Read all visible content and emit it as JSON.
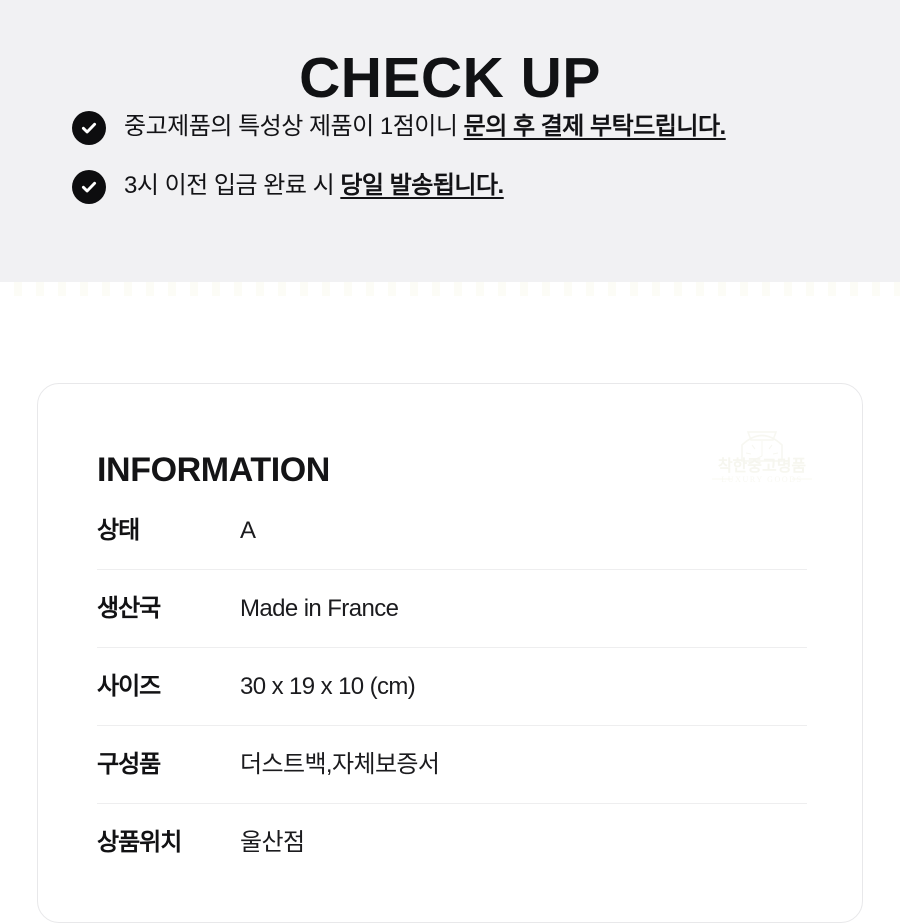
{
  "checkup": {
    "title": "CHECK UP",
    "bullets": [
      {
        "icon": "check-circle-icon",
        "normal": "중고제품의 특성상 제품이 1점이니 ",
        "emphasis": "문의 후 결제 부탁드립니다."
      },
      {
        "icon": "check-circle-icon",
        "normal": "3시 이전 입금 완료 시 ",
        "emphasis": "당일 발송됩니다."
      }
    ]
  },
  "information": {
    "title": "INFORMATION",
    "watermark": {
      "name": "착한중고명품",
      "subtitle": "LUXURY GOODS",
      "icon": "watch-outline-icon"
    },
    "rows": [
      {
        "label": "상태",
        "value": "A"
      },
      {
        "label": "생산국",
        "value": "Made in France"
      },
      {
        "label": "사이즈",
        "value": "30 x 19 x 10 (cm)"
      },
      {
        "label": "구성품",
        "value": "더스트백,자체보증서"
      },
      {
        "label": "상품위치",
        "value": "울산점"
      }
    ]
  },
  "colors": {
    "banner_background": "#f1f1f3",
    "page_background": "#ffffff",
    "text_primary": "#121214",
    "icon_fill": "#0d0d0f",
    "card_border": "#e8e8ea",
    "divider": "#eeeeef",
    "watermark": "#fafaf6"
  }
}
